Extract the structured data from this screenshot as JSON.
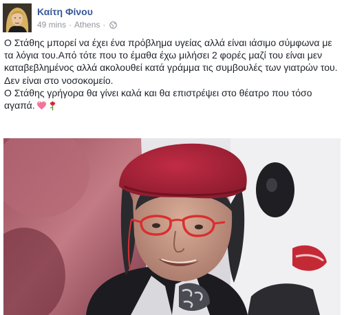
{
  "post": {
    "author_name": "Καίτη Φίνου",
    "timestamp": "49 mins",
    "location": "Athens",
    "separator": "·",
    "privacy_icon": "globe-icon",
    "paragraphs": [
      "Ο Στάθης μπορεί να έχει ένα πρόβλημα υγείας αλλά είναι ιάσιμο σύμφωνα με τα λόγια του.Από τότε που το έμαθα έχω μιλήσει 2 φορές μαζί του είναι μεν καταβεβλημένος αλλά ακολουθεί κατά γράμμα τις συμβουλές των γιατρών του.",
      "Δεν είναι στο νοσοκομείο.",
      "Ο Στάθης γρήγορα θα γίνει καλά και θα επιστρέψει στο θέατρο που τόσο αγαπά."
    ],
    "emojis": [
      "sparkling-heart-icon",
      "rose-icon"
    ]
  },
  "colors": {
    "author_link": "#365899",
    "meta_text": "#90949c",
    "body_text": "#1d2129",
    "beret": "#b0233a",
    "glasses": "#d92f2f"
  }
}
